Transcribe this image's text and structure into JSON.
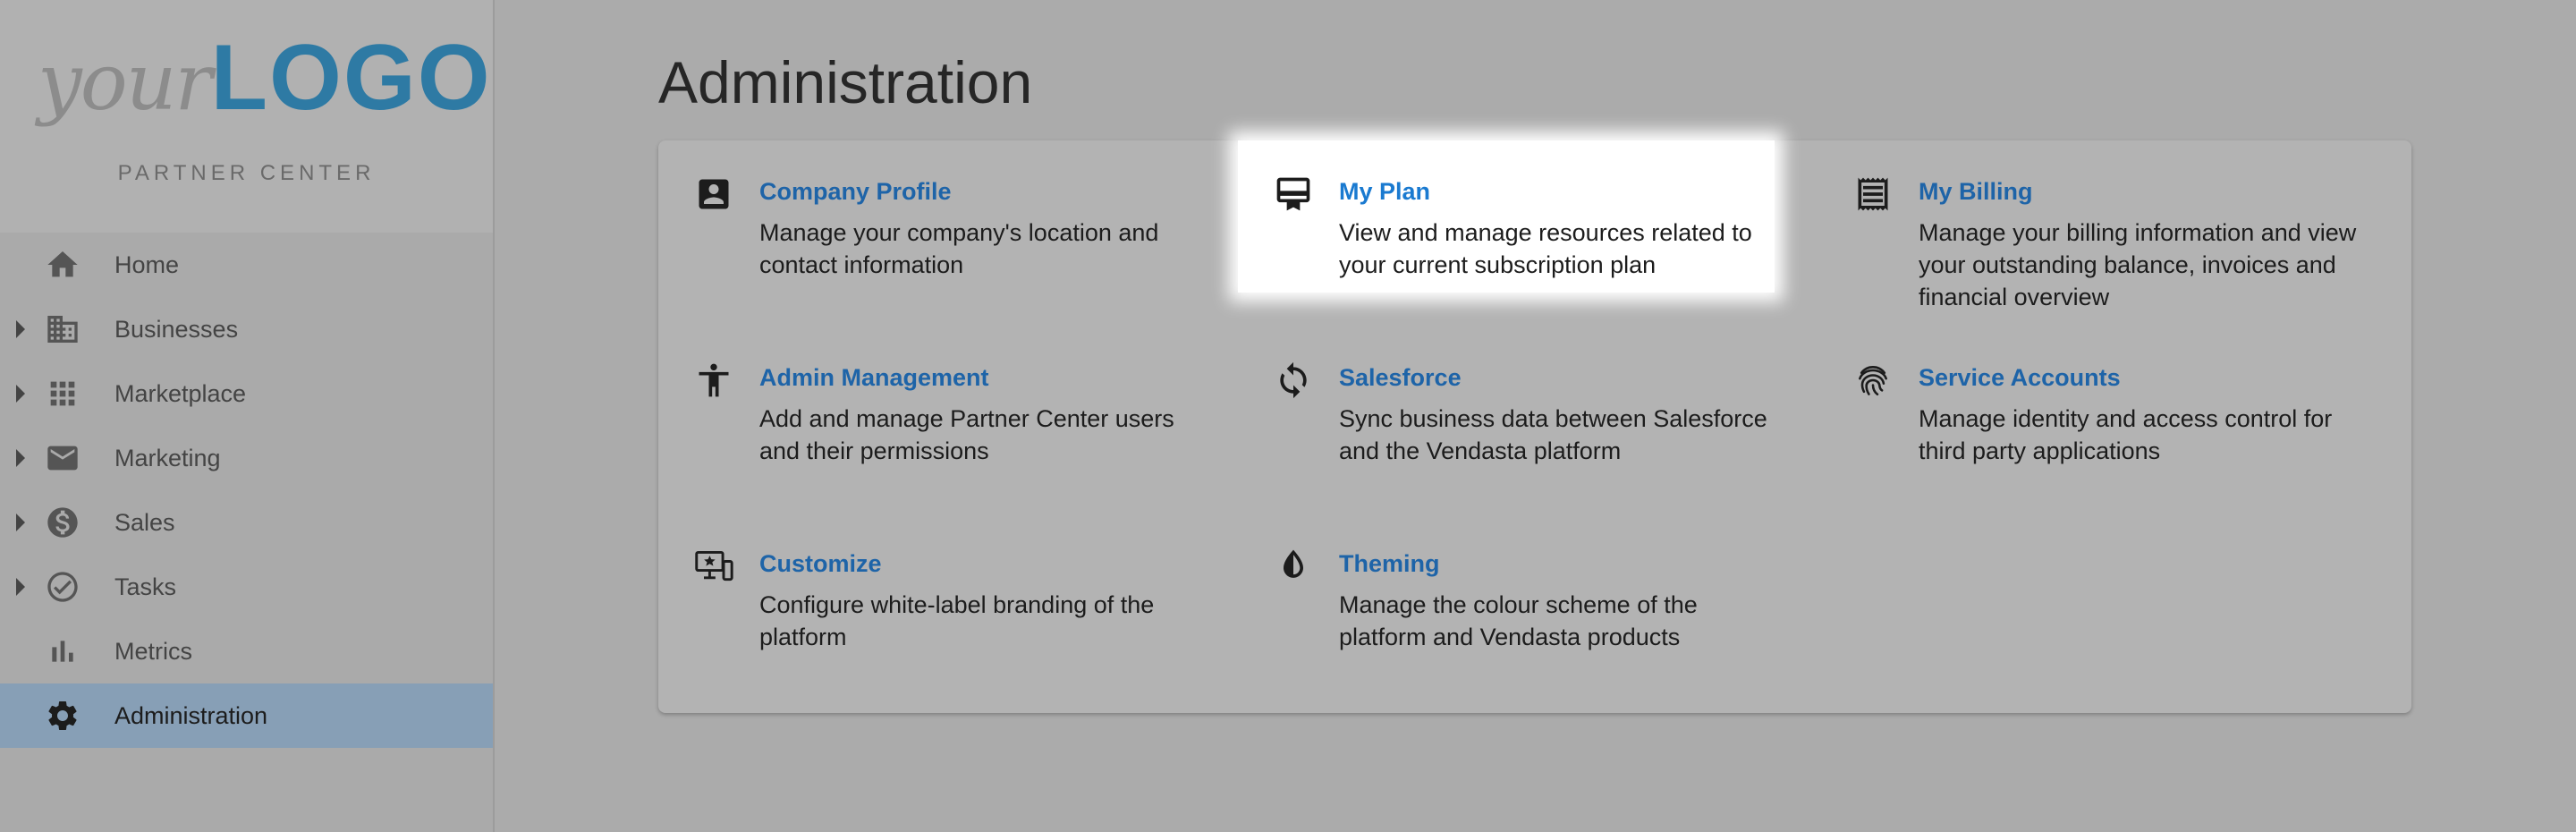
{
  "sidebar": {
    "logo": {
      "your": "your",
      "mark": "LOGO"
    },
    "subtitle": "PARTNER CENTER",
    "items": [
      {
        "label": "Home",
        "icon": "home-icon",
        "expandable": false,
        "active": false
      },
      {
        "label": "Businesses",
        "icon": "building-icon",
        "expandable": true,
        "active": false
      },
      {
        "label": "Marketplace",
        "icon": "grid-icon",
        "expandable": true,
        "active": false
      },
      {
        "label": "Marketing",
        "icon": "mail-icon",
        "expandable": true,
        "active": false
      },
      {
        "label": "Sales",
        "icon": "dollar-icon",
        "expandable": true,
        "active": false
      },
      {
        "label": "Tasks",
        "icon": "check-circle-icon",
        "expandable": true,
        "active": false
      },
      {
        "label": "Metrics",
        "icon": "bar-chart-icon",
        "expandable": false,
        "active": false
      },
      {
        "label": "Administration",
        "icon": "gear-icon",
        "expandable": false,
        "active": true
      }
    ]
  },
  "main": {
    "title": "Administration",
    "tiles": [
      {
        "title": "Company Profile",
        "icon": "account-box-icon",
        "description": "Manage your company's location and contact information"
      },
      {
        "title": "My Plan",
        "icon": "card-membership-icon",
        "description": "View and manage resources related to your current subscription plan",
        "highlighted": true
      },
      {
        "title": "My Billing",
        "icon": "receipt-icon",
        "description": "Manage your billing information and view your outstanding balance, invoices and financial overview"
      },
      {
        "title": "Admin Management",
        "icon": "accessibility-icon",
        "description": "Add and manage Partner Center users and their permissions"
      },
      {
        "title": "Salesforce",
        "icon": "sync-icon",
        "description": "Sync business data between Salesforce and the Vendasta platform"
      },
      {
        "title": "Service Accounts",
        "icon": "fingerprint-icon",
        "description": "Manage identity and access control for third party applications"
      },
      {
        "title": "Customize",
        "icon": "devices-icon",
        "description": "Configure white-label branding of the platform"
      },
      {
        "title": "Theming",
        "icon": "contrast-icon",
        "description": "Manage the colour scheme of the platform and Vendasta products"
      }
    ]
  },
  "colors": {
    "link": "#1e64a8",
    "brand": "#2e7aa4",
    "active_nav": "#879fb6"
  }
}
